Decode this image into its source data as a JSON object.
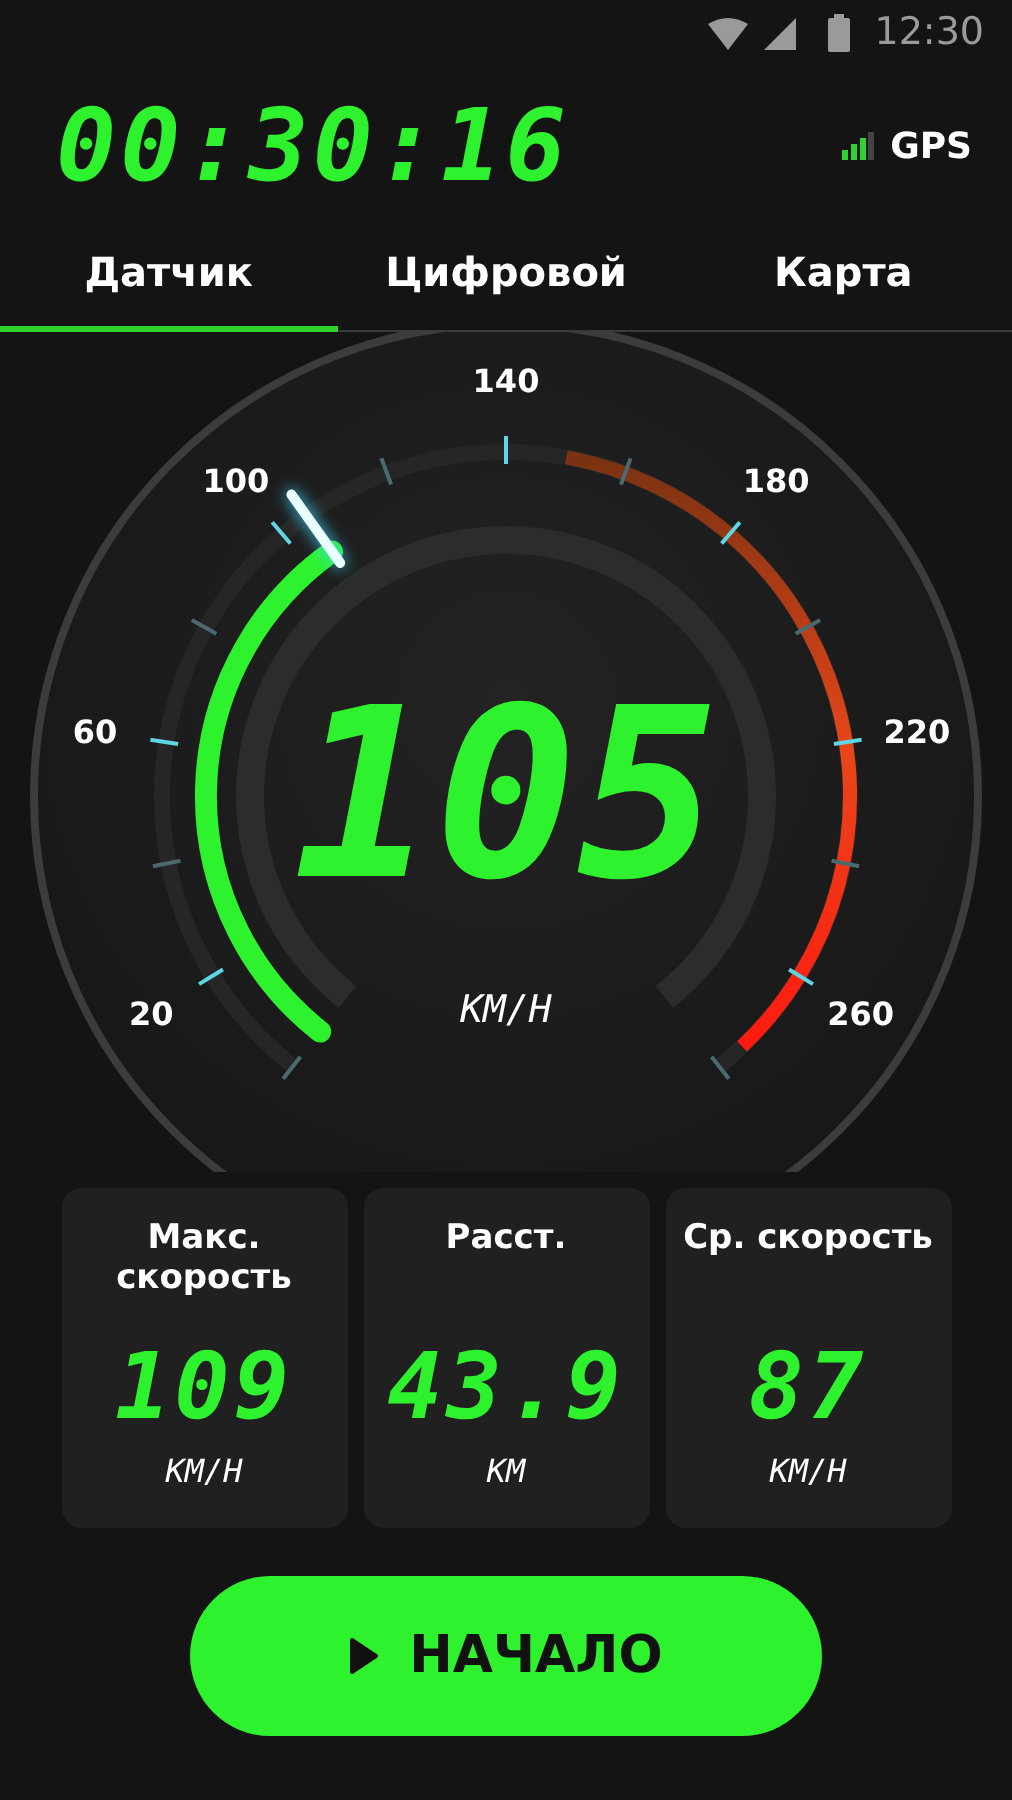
{
  "status_bar": {
    "time": "12:30"
  },
  "timer": "00:30:16",
  "gps": {
    "label": "GPS"
  },
  "tabs": [
    {
      "label": "Датчик",
      "selected": true
    },
    {
      "label": "Цифровой",
      "selected": false
    },
    {
      "label": "Карта",
      "selected": false
    }
  ],
  "gauge": {
    "labels": [
      "20",
      "60",
      "100",
      "140",
      "180",
      "220",
      "260"
    ],
    "reading": "105",
    "unit": "КМ/Н"
  },
  "stats": [
    {
      "label": "Макс. скорость",
      "value": "109",
      "unit": "КМ/Н"
    },
    {
      "label": "Расст.",
      "value": "43.9",
      "unit": "КМ"
    },
    {
      "label": "Ср. скорость",
      "value": "87",
      "unit": "КМ/Н"
    }
  ],
  "start_button": {
    "label": "НАЧАЛО"
  }
}
